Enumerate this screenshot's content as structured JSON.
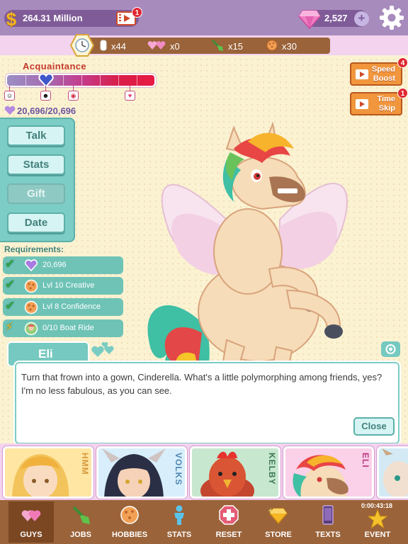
{
  "top_bar": {
    "currency_symbol": "$",
    "money": "264.31 Million",
    "money_badge": "1",
    "gems": "2,527",
    "gem_plus": "+"
  },
  "resources": {
    "tokens": "x44",
    "hearts": "x0",
    "shovels": "x15",
    "balls": "x30"
  },
  "acquaintance": {
    "title": "Acquaintance",
    "value": "20,696/20,696",
    "progress_fraction": 0.27
  },
  "boosts": {
    "speed_line1": "Speed",
    "speed_line2": "Boost",
    "speed_badge": "4",
    "time_line1": "Time",
    "time_line2": "Skip",
    "time_badge": "1"
  },
  "actions": {
    "talk": "Talk",
    "stats": "Stats",
    "gift": "Gift",
    "date": "Date"
  },
  "requirements": {
    "title": "Requirements:",
    "items": [
      {
        "text": "20,696",
        "icon": "hearts-icon",
        "met": true
      },
      {
        "text": "Lvl 10 Creative",
        "icon": "ball-icon",
        "met": true
      },
      {
        "text": "Lvl 8 Confidence",
        "icon": "ball-icon",
        "met": true
      },
      {
        "text": "0/10 Boat Ride",
        "icon": "date-portrait-icon",
        "met": false
      }
    ]
  },
  "dialog": {
    "speaker": "Eli",
    "text": "Turn that frown into a gown, Cinderella. What's a little polymorphing among friends, yes? I'm no less fabulous, as you can see.",
    "close": "Close"
  },
  "characters": [
    {
      "name": "HMM"
    },
    {
      "name": "VOLKS"
    },
    {
      "name": "KELBY"
    },
    {
      "name": "ELI"
    }
  ],
  "nav": {
    "guys": "GUYS",
    "jobs": "JOBS",
    "hobbies": "HOBBIES",
    "stats": "STATS",
    "reset": "RESET",
    "store": "STORE",
    "texts": "TEXTS",
    "event": "EVENT",
    "event_timer": "0:00:43:18"
  },
  "colors": {
    "top_bar": "#a88bbd",
    "teal_panel": "#7ccdc5",
    "nav_brown": "#9a6339",
    "acquaintance_red": "#c5392b"
  }
}
